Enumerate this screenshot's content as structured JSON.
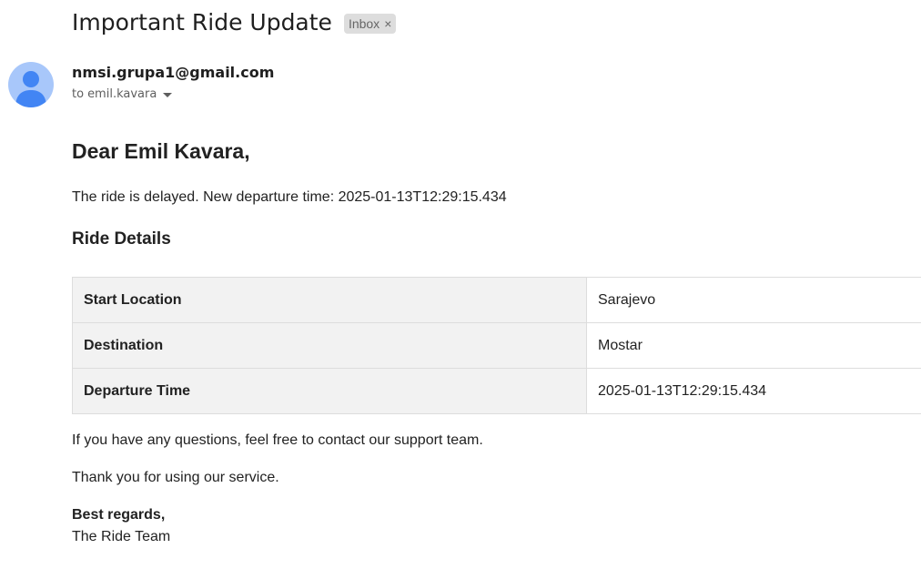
{
  "email": {
    "subject": "Important Ride Update",
    "label": "Inbox",
    "label_close": "×",
    "sender": "nmsi.grupa1@gmail.com",
    "to_prefix": "to",
    "recipient": "emil.kavara"
  },
  "message": {
    "greeting": "Dear Emil Kavara,",
    "delay_text": "The ride is delayed. New departure time: 2025-01-13T12:29:15.434",
    "details_heading": "Ride Details",
    "details": [
      {
        "key": "Start Location",
        "value": "Sarajevo"
      },
      {
        "key": "Destination",
        "value": "Mostar"
      },
      {
        "key": "Departure Time",
        "value": "2025-01-13T12:29:15.434"
      }
    ],
    "questions_text": "If you have any questions, feel free to contact our support team.",
    "thanks_text": "Thank you for using our service.",
    "regards": "Best regards,",
    "signature": "The Ride Team"
  },
  "icons": {
    "avatar": "person-avatar-icon",
    "recipient_details": "caret-down-icon"
  },
  "colors": {
    "avatar_bg": "#a8c7fa",
    "avatar_fg": "#4285f4",
    "label_bg": "#dddddd",
    "table_key_bg": "#f2f2f2"
  }
}
